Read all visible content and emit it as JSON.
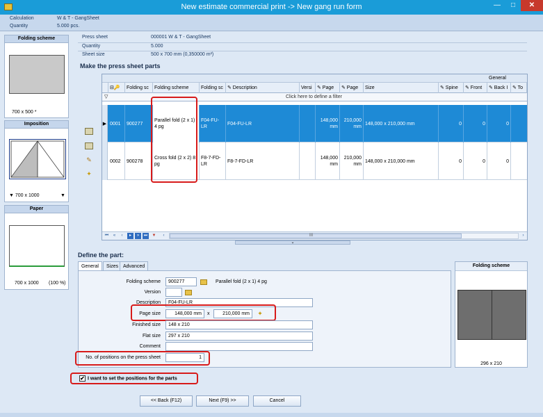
{
  "window": {
    "title": "New estimate commercial print -> New gang run form",
    "minimize": "—",
    "maximize": "□",
    "close": "✕"
  },
  "info": {
    "calc_label": "Calculation",
    "calc_value": "W & T - GangSheet",
    "qty_label": "Quantity",
    "qty_value": "5.000 pcs."
  },
  "left": {
    "folding_title": "Folding scheme",
    "folding_caption": "700 x 500 *",
    "imposition_title": "Imposition",
    "imposition_caption": "▼ 700 x 1000",
    "imposition_arrow": "▼",
    "paper_title": "Paper",
    "paper_caption": "700 x 1000",
    "paper_pct": "(100 %)"
  },
  "press_sheet": {
    "label": "Press sheet",
    "value": "000001 W & T - GangSheet",
    "qty_label": "Quantity",
    "qty_value": "5.000",
    "size_label": "Sheet size",
    "size_value": "500 x 700 mm (0,350000 m²)"
  },
  "section": {
    "make_parts": "Make the press sheet parts",
    "define_part": "Define the part:"
  },
  "grid": {
    "group_label": "General",
    "columns": [
      "⊟🔑",
      "Folding sc",
      "Folding scheme",
      "Folding sc",
      "✎ Description",
      "Versi",
      "✎ Page",
      "✎ Page",
      "Size",
      "✎ Spine",
      "✎ Front",
      "✎ Back I",
      "✎ To"
    ],
    "filter_text": "Click here to define a filter",
    "rows": [
      {
        "num": "0001",
        "code": "900277",
        "scheme": "Parallel fold (2 x 1) 4 pg",
        "scheme_code": "F04-FU-LR",
        "description": "F04-FU-LR",
        "version": "",
        "page_w": "148,000 mm",
        "page_h": "210,000 mm",
        "size": "148,000 x 210,000 mm",
        "spine": "0",
        "front": "0",
        "back": "0"
      },
      {
        "num": "0002",
        "code": "900278",
        "scheme": "Cross fold (2 x 2) 8 pg",
        "scheme_code": "F8-7-FD-LR",
        "description": "F8-7-FD-LR",
        "version": "",
        "page_w": "148,000 mm",
        "page_h": "210,000 mm",
        "size": "148,000 x 210,000 mm",
        "spine": "0",
        "front": "0",
        "back": "0"
      }
    ],
    "nav_first": "⏮",
    "nav_prev2": "«",
    "nav_prev": "‹",
    "nav_next": "▸",
    "nav_next2": "»",
    "nav_last": "⏭",
    "scroll_left": "‹",
    "scroll_right": "›",
    "scroll_grip": "III"
  },
  "tabs": [
    "General",
    "Sizes",
    "Advanced"
  ],
  "form": {
    "folding_scheme_label": "Folding scheme",
    "folding_scheme_value": "900277",
    "folding_scheme_text": "Parallel fold (2 x 1) 4 pg",
    "version_label": "Version",
    "version_value": "",
    "description_label": "Description",
    "description_value": "F04-FU-LR",
    "page_size_label": "Page size",
    "page_w": "148,000 mm",
    "page_x": "x",
    "page_h": "210,000 mm",
    "finished_label": "Finished size",
    "finished_value": "148 x 210",
    "flat_label": "Flat size",
    "flat_value": "297 x 210",
    "comment_label": "Comment",
    "comment_value": "",
    "positions_label": "No. of positions on the press sheet",
    "positions_value": "1"
  },
  "preview": {
    "title": "Folding scheme",
    "caption": "296 x 210"
  },
  "checkbox": {
    "label": "I want to set the positions for the parts",
    "checked": "✔"
  },
  "buttons": {
    "back": "<< Back (F12)",
    "next": "Next (F9) >>",
    "cancel": "Cancel"
  },
  "colors": {
    "titlebar": "#1a9cd8",
    "selection": "#1e8ad6",
    "highlight": "#d71a1a"
  }
}
